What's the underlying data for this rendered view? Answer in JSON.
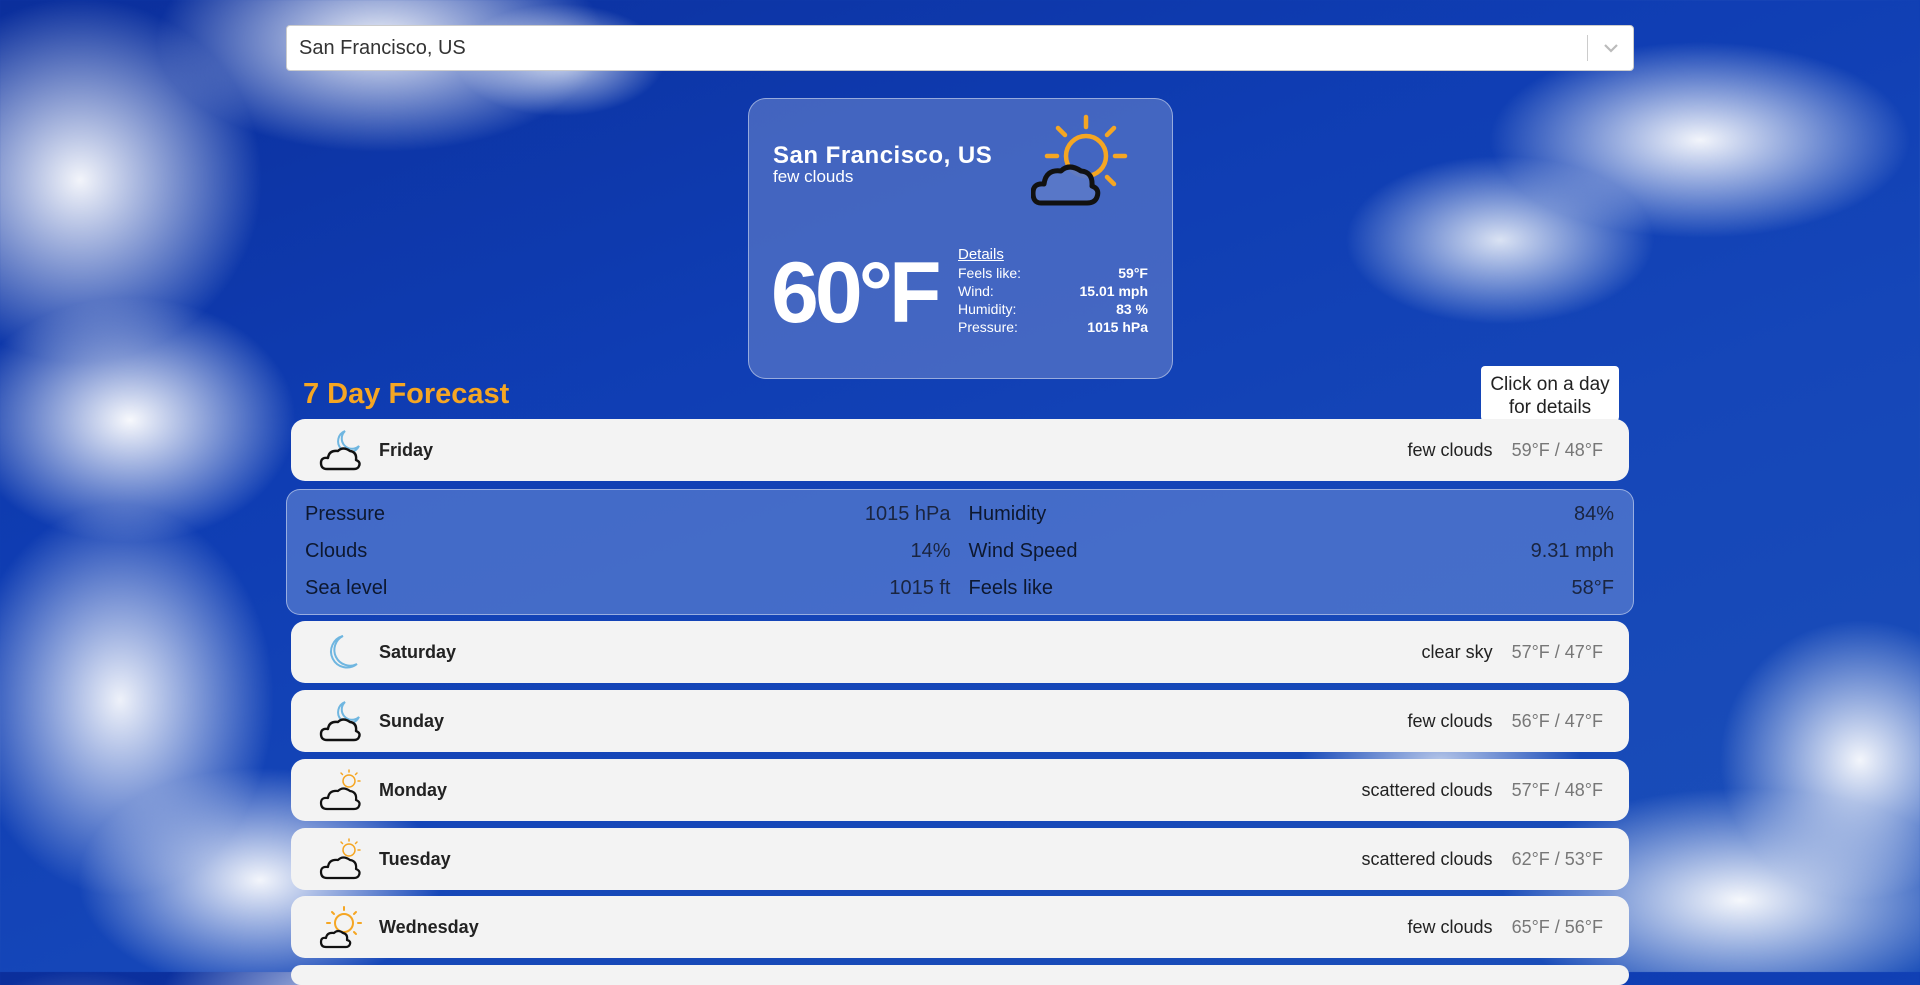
{
  "search": {
    "value": "San Francisco, US"
  },
  "current": {
    "city": "San Francisco, US",
    "description": "few clouds",
    "icon": "sun-cloud-icon",
    "temperature": "60°F",
    "details_heading": "Details",
    "details": [
      {
        "label": "Feels like:",
        "value": "59°F"
      },
      {
        "label": "Wind:",
        "value": "15.01 mph"
      },
      {
        "label": "Humidity:",
        "value": "83 %"
      },
      {
        "label": "Pressure:",
        "value": "1015 hPa"
      }
    ]
  },
  "forecast": {
    "title": "7 Day Forecast",
    "hint": "Click on a day for details",
    "days": [
      {
        "day": "Friday",
        "condition": "few clouds",
        "range": "59°F / 48°F",
        "icon": "moon-cloud-icon"
      },
      {
        "day": "Saturday",
        "condition": "clear sky",
        "range": "57°F / 47°F",
        "icon": "moon-icon"
      },
      {
        "day": "Sunday",
        "condition": "few clouds",
        "range": "56°F / 47°F",
        "icon": "moon-cloud-icon"
      },
      {
        "day": "Monday",
        "condition": "scattered clouds",
        "range": "57°F / 48°F",
        "icon": "sun-cloud-small-icon"
      },
      {
        "day": "Tuesday",
        "condition": "scattered clouds",
        "range": "62°F / 53°F",
        "icon": "sun-cloud-small-icon"
      },
      {
        "day": "Wednesday",
        "condition": "few clouds",
        "range": "65°F / 56°F",
        "icon": "sun-cloud-icon"
      }
    ],
    "expanded_details": {
      "left": [
        {
          "label": "Pressure",
          "value": "1015 hPa"
        },
        {
          "label": "Clouds",
          "value": "14%"
        },
        {
          "label": "Sea level",
          "value": "1015 ft"
        }
      ],
      "right": [
        {
          "label": "Humidity",
          "value": "84%"
        },
        {
          "label": "Wind Speed",
          "value": "9.31 mph"
        },
        {
          "label": "Feels like",
          "value": "58°F"
        }
      ]
    }
  },
  "colors": {
    "accent": "#f5a623",
    "moon": "#6fb6e0"
  }
}
